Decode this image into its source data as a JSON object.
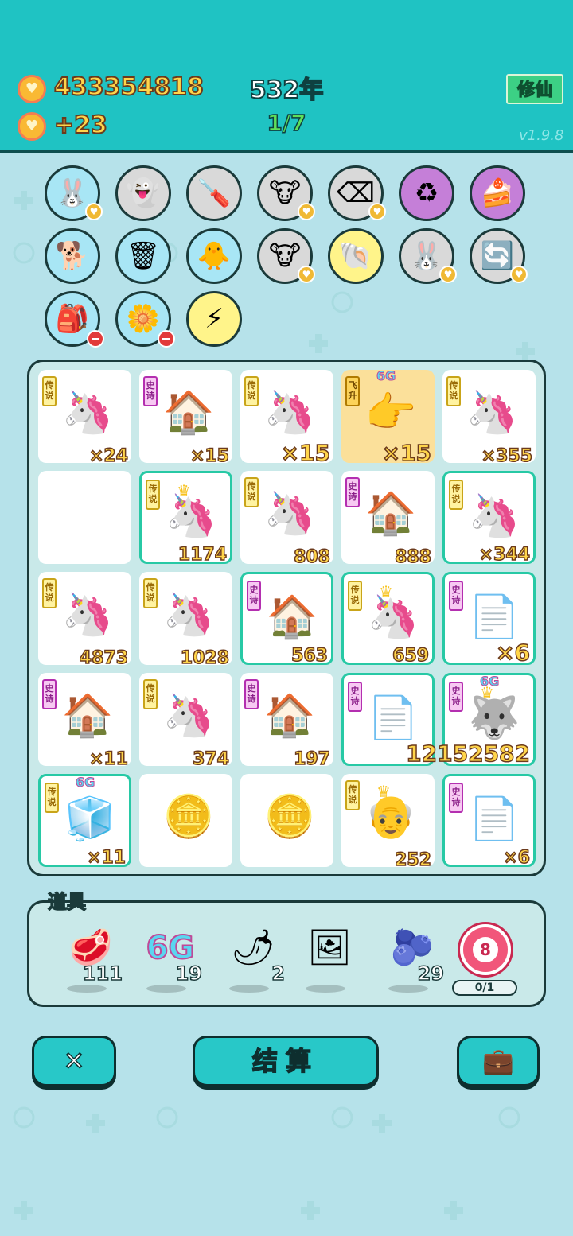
{
  "header": {
    "coins": "433354818",
    "coin_rate": "+23",
    "year": "532年",
    "progress": "1/7",
    "cultivate_button": "修仙",
    "version": "v1.9.8"
  },
  "abilities": [
    {
      "name": "bunny-ability",
      "glyph": "🐰",
      "bg": "#a8e6f5",
      "badge": "heart"
    },
    {
      "name": "ghost-ability",
      "glyph": "👻",
      "bg": "#d9d9d9",
      "badge": ""
    },
    {
      "name": "screwdriver-ability",
      "glyph": "🪛",
      "bg": "#d9d9d9",
      "badge": ""
    },
    {
      "name": "cow-pair-ability",
      "glyph": "🐮",
      "bg": "#d9d9d9",
      "badge": "heart"
    },
    {
      "name": "delete-ability",
      "glyph": "⌫",
      "bg": "#d9d9d9",
      "badge": "heart"
    },
    {
      "name": "recycle-ability",
      "glyph": "♻",
      "bg": "#c57fd8",
      "badge": ""
    },
    {
      "name": "cake-ability",
      "glyph": "🍰",
      "bg": "#c57fd8",
      "badge": ""
    },
    {
      "name": "dog-ability",
      "glyph": "🐕",
      "bg": "#a8e6f5",
      "badge": ""
    },
    {
      "name": "trash-bag-ability",
      "glyph": "🗑",
      "bg": "#a8e6f5",
      "badge": ""
    },
    {
      "name": "chick-ability",
      "glyph": "🐥",
      "bg": "#a8e6f5",
      "badge": ""
    },
    {
      "name": "cow-pair-ability-2",
      "glyph": "🐮",
      "bg": "#d9d9d9",
      "badge": "heart"
    },
    {
      "name": "shell-ability",
      "glyph": "🐚",
      "bg": "#fff48a",
      "badge": ""
    },
    {
      "name": "bunny-ability-2",
      "glyph": "🐰",
      "bg": "#d9d9d9",
      "badge": "heart"
    },
    {
      "name": "refresh-ability",
      "glyph": "🔄",
      "bg": "#d9d9d9",
      "badge": "heart"
    },
    {
      "name": "rice-bag-ability",
      "glyph": "🎒",
      "bg": "#a8e6f5",
      "badge": "minus"
    },
    {
      "name": "flower-pot-ability",
      "glyph": "🌼",
      "bg": "#a8e6f5",
      "badge": "minus"
    },
    {
      "name": "lightning-ability",
      "glyph": "⚡",
      "bg": "#fff48a",
      "badge": ""
    }
  ],
  "board": [
    {
      "tag": "leg",
      "tag_text": "传说",
      "art": "🦄",
      "count": "×24",
      "hl": false,
      "gold": false
    },
    {
      "tag": "epic",
      "tag_text": "史诗",
      "art": "🏠",
      "count": "×15",
      "hl": false,
      "gold": false
    },
    {
      "tag": "leg",
      "tag_text": "传说",
      "art": "🦄",
      "count": "×15",
      "hl": false,
      "gold": false,
      "big": true
    },
    {
      "tag": "fly",
      "tag_text": "飞升",
      "art": "👉",
      "count": "×15",
      "hl": false,
      "gold": true,
      "big": true,
      "sixg": "6G"
    },
    {
      "tag": "leg",
      "tag_text": "传说",
      "art": "🦄",
      "count": "×355",
      "hl": false,
      "gold": false
    },
    {
      "tag": "",
      "tag_text": "",
      "art": "",
      "count": "",
      "hl": false,
      "gold": false
    },
    {
      "tag": "leg",
      "tag_text": "传说",
      "art": "🦄",
      "count": "1174",
      "hl": true,
      "gold": false,
      "crown": true
    },
    {
      "tag": "leg",
      "tag_text": "传说",
      "art": "🦄",
      "count": "808",
      "hl": false,
      "gold": false
    },
    {
      "tag": "epic",
      "tag_text": "史诗",
      "art": "🏠",
      "count": "888",
      "hl": false,
      "gold": false
    },
    {
      "tag": "leg",
      "tag_text": "传说",
      "art": "🦄",
      "count": "×344",
      "hl": true,
      "gold": false
    },
    {
      "tag": "leg",
      "tag_text": "传说",
      "art": "🦄",
      "count": "4873",
      "hl": false,
      "gold": false
    },
    {
      "tag": "leg",
      "tag_text": "传说",
      "art": "🦄",
      "count": "1028",
      "hl": false,
      "gold": false
    },
    {
      "tag": "epic",
      "tag_text": "史诗",
      "art": "🏠",
      "count": "563",
      "hl": true,
      "gold": false
    },
    {
      "tag": "leg",
      "tag_text": "传说",
      "art": "🦄",
      "count": "659",
      "hl": true,
      "gold": false,
      "crown": true
    },
    {
      "tag": "epic",
      "tag_text": "史诗",
      "art": "📄",
      "count": "×6",
      "hl": true,
      "gold": false,
      "big": true
    },
    {
      "tag": "epic",
      "tag_text": "史诗",
      "art": "🏠",
      "count": "×11",
      "hl": false,
      "gold": false
    },
    {
      "tag": "leg",
      "tag_text": "传说",
      "art": "🦄",
      "count": "374",
      "hl": false,
      "gold": false
    },
    {
      "tag": "epic",
      "tag_text": "史诗",
      "art": "🏠",
      "count": "197",
      "hl": false,
      "gold": false
    },
    {
      "tag": "epic",
      "tag_text": "史诗",
      "art": "📄",
      "count": "",
      "hl": true,
      "gold": false
    },
    {
      "tag": "epic",
      "tag_text": "史诗",
      "art": "🐺",
      "count": "12152582",
      "hl": true,
      "gold": false,
      "big": true,
      "sixg": "6G",
      "crown": true
    },
    {
      "tag": "leg",
      "tag_text": "传说",
      "art": "🧊",
      "count": "×11",
      "hl": true,
      "gold": false,
      "sixg": "6G"
    },
    {
      "tag": "",
      "tag_text": "",
      "art": "🪙",
      "count": "",
      "hl": false,
      "gold": false
    },
    {
      "tag": "",
      "tag_text": "",
      "art": "🪙",
      "count": "",
      "hl": false,
      "gold": false
    },
    {
      "tag": "leg",
      "tag_text": "传说",
      "art": "👴",
      "count": "252",
      "hl": false,
      "gold": false,
      "crown": true
    },
    {
      "tag": "epic",
      "tag_text": "史诗",
      "art": "📄",
      "count": "×6",
      "hl": true,
      "gold": false
    }
  ],
  "tools": {
    "title": "道具",
    "items": [
      {
        "name": "liver-tool",
        "glyph": "🥩",
        "count": "111"
      },
      {
        "name": "six-g-tool",
        "glyph": "6G",
        "count": "19"
      },
      {
        "name": "pepper-tool",
        "glyph": "🌶",
        "count": "2"
      },
      {
        "name": "frame-tool",
        "glyph": "🖼",
        "count": ""
      },
      {
        "name": "blueberry-tool",
        "glyph": "🫐",
        "count": "29"
      }
    ],
    "target_number": "8",
    "target_progress": "0/1"
  },
  "bottom": {
    "delete_glyph": "✕",
    "settle_label": "结算",
    "bag_glyph": "💼"
  }
}
